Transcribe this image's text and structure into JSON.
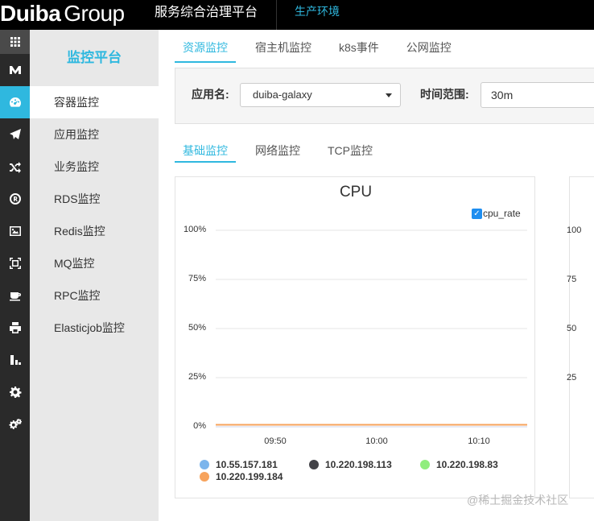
{
  "header": {
    "logo_bold": "Duiba",
    "logo_light": "Group",
    "service_title": "服务综合治理平台",
    "environment": "生产环境"
  },
  "iconbar": [
    {
      "name": "grid-icon",
      "active": false
    },
    {
      "name": "m-logo-icon",
      "active": false
    },
    {
      "name": "dashboard-icon",
      "active": true
    },
    {
      "name": "paper-plane-icon",
      "active": false
    },
    {
      "name": "shuffle-icon",
      "active": false
    },
    {
      "name": "registered-icon",
      "active": false
    },
    {
      "name": "image-icon",
      "active": false
    },
    {
      "name": "frame-icon",
      "active": false
    },
    {
      "name": "coffee-icon",
      "active": false
    },
    {
      "name": "printer-icon",
      "active": false
    },
    {
      "name": "chart-bar-icon",
      "active": false
    },
    {
      "name": "gear-icon",
      "active": false
    },
    {
      "name": "gears-icon",
      "active": false
    }
  ],
  "sidebar": {
    "title": "监控平台",
    "items": [
      {
        "label": "容器监控",
        "active": true
      },
      {
        "label": "应用监控",
        "active": false
      },
      {
        "label": "业务监控",
        "active": false
      },
      {
        "label": "RDS监控",
        "active": false
      },
      {
        "label": "Redis监控",
        "active": false
      },
      {
        "label": "MQ监控",
        "active": false
      },
      {
        "label": "RPC监控",
        "active": false
      },
      {
        "label": "Elasticjob监控",
        "active": false
      }
    ]
  },
  "top_tabs": [
    {
      "label": "资源监控",
      "active": true
    },
    {
      "label": "宿主机监控",
      "active": false
    },
    {
      "label": "k8s事件",
      "active": false
    },
    {
      "label": "公网监控",
      "active": false
    }
  ],
  "filters": {
    "app_label": "应用名:",
    "app_value": "duiba-galaxy",
    "time_label": "时间范围:",
    "time_value": "30m"
  },
  "sub_tabs": [
    {
      "label": "基础监控",
      "active": true
    },
    {
      "label": "网络监控",
      "active": false
    },
    {
      "label": "TCP监控",
      "active": false
    }
  ],
  "chart_data": {
    "type": "line",
    "title": "CPU",
    "toggle_label": "cpu_rate",
    "toggle_checked": true,
    "y_ticks": [
      "100%",
      "75%",
      "50%",
      "25%",
      "0%"
    ],
    "x_ticks": [
      "09:50",
      "10:00",
      "10:10"
    ],
    "ylim": [
      0,
      100
    ],
    "grid": true,
    "legend_position": "bottom",
    "series": [
      {
        "name": "10.55.157.181",
        "color": "#7cb5ec",
        "values": [
          1,
          1,
          1,
          1,
          1,
          1
        ]
      },
      {
        "name": "10.220.198.113",
        "color": "#434348",
        "values": [
          1,
          1,
          1,
          1,
          1,
          1
        ]
      },
      {
        "name": "10.220.198.83",
        "color": "#90ed7d",
        "values": [
          1,
          1,
          1,
          1,
          1,
          1
        ]
      },
      {
        "name": "10.220.199.184",
        "color": "#f7a35c",
        "values": [
          1,
          1,
          1,
          1,
          1,
          1
        ]
      }
    ]
  },
  "second_chart": {
    "y_ticks": [
      "100",
      "75",
      "50",
      "25"
    ]
  },
  "watermark": "@稀土掘金技术社区"
}
